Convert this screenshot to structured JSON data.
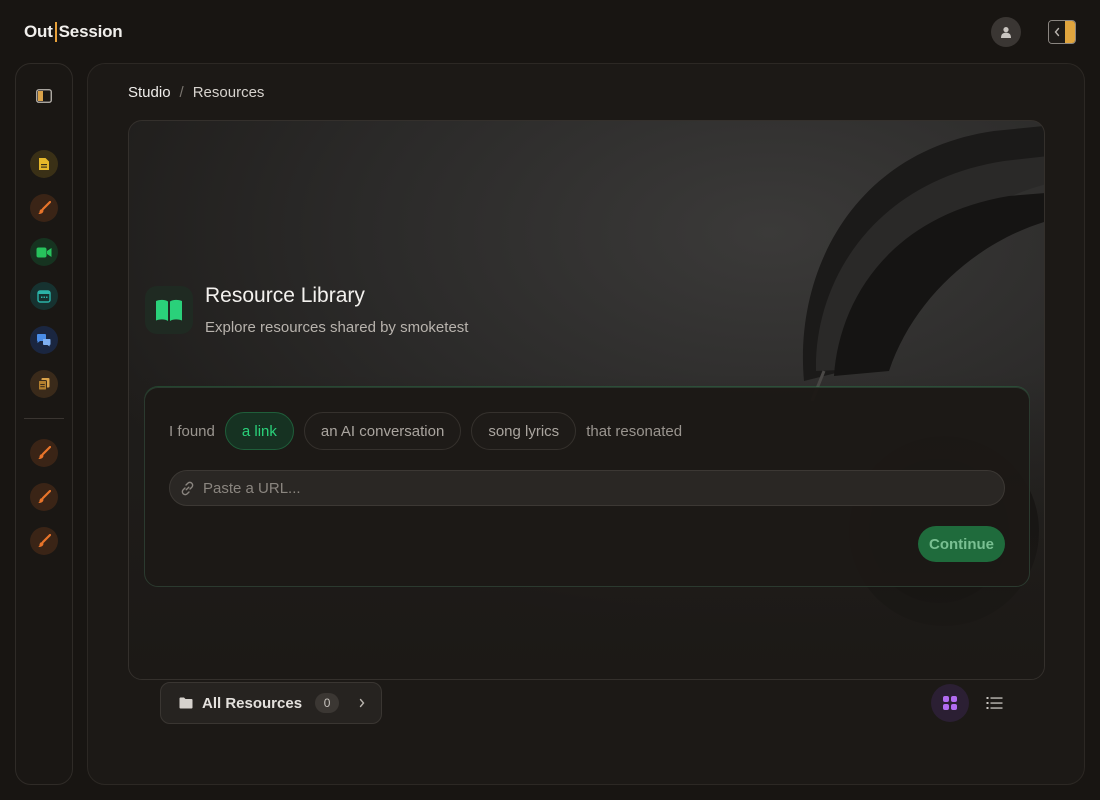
{
  "app": {
    "logo_left": "Out",
    "logo_right": "Session"
  },
  "header": {
    "user_icon": "user-icon",
    "panel_icon": "panel-toggle-icon"
  },
  "sidebar": {
    "items": [
      {
        "icon": "sidebar-collapse-icon",
        "color": "#d9a24a"
      },
      {
        "icon": "document-icon",
        "color": "#e6b82a"
      },
      {
        "icon": "brush-icon",
        "color": "#e8742a"
      },
      {
        "icon": "video-icon",
        "color": "#27c25c"
      },
      {
        "icon": "calendar-icon",
        "color": "#2bb3a8"
      },
      {
        "icon": "chat-bubbles-icon",
        "color": "#4a8de8"
      },
      {
        "icon": "copy-documents-icon",
        "color": "#d9a24a"
      },
      {
        "icon": "brush-icon",
        "color": "#e8742a"
      },
      {
        "icon": "brush-icon",
        "color": "#e8742a"
      },
      {
        "icon": "brush-icon",
        "color": "#e8742a"
      }
    ]
  },
  "breadcrumb": {
    "root": "Studio",
    "separator": "/",
    "current": "Resources"
  },
  "library": {
    "title": "Resource Library",
    "subtitle": "Explore resources shared by smoketest",
    "icon": "open-book-icon",
    "accent": "#2ad17a"
  },
  "finder": {
    "prefix": "I found",
    "options": [
      "a link",
      "an AI conversation",
      "song lyrics"
    ],
    "selected": "a link",
    "suffix": "that resonated",
    "url_placeholder": "Paste a URL...",
    "url_value": "",
    "continue_label": "Continue"
  },
  "footer": {
    "all_resources_label": "All Resources",
    "count": "0",
    "view_mode": "grid"
  }
}
